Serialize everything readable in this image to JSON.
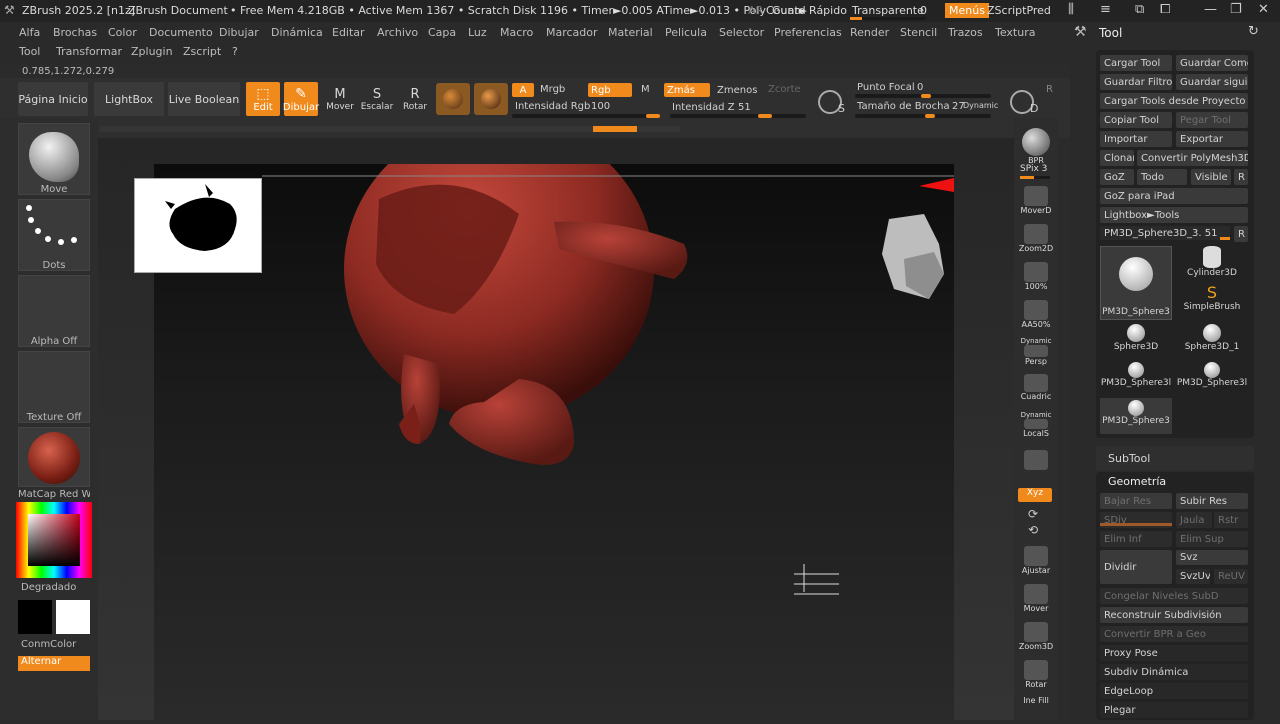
{
  "titlebar": {
    "app": "ZBrush 2025.2 [n1z]",
    "document": "ZBrush Document",
    "stats": "• Free Mem 4.218GB • Active Mem 1367 • Scratch Disk 1196 • Timer►0.005 ATime►0.013 • PolyCount►",
    "ar": "AR",
    "quicksave": "Guard Rápido",
    "transparent": "Transparente",
    "transparent_value": "0",
    "menus": "Menús",
    "zscript": "ZScriptPred"
  },
  "menus": {
    "row1": [
      "Alfa",
      "Brochas",
      "Color",
      "Documento",
      "Dibujar",
      "Dinámica",
      "Editar",
      "Archivo",
      "Capa",
      "Luz",
      "Macro",
      "Marcador",
      "Material",
      "Pelicula",
      "Selector",
      "Preferencias",
      "Render",
      "Stencil",
      "Trazos",
      "Textura"
    ],
    "row2": [
      "Tool",
      "Transformar",
      "Zplugin",
      "Zscript",
      "?"
    ]
  },
  "coords": "0.785,1.272,0.279",
  "shelf": {
    "home": "Página Inicio",
    "lightbox": "LightBox",
    "liveboolean": "Live Boolean",
    "edit": "Edit",
    "draw": "Dibujar",
    "move": "Mover",
    "scale": "Escalar",
    "rotate": "Rotar",
    "a": "A",
    "mrgb": "Mrgb",
    "rgb": "Rgb",
    "m": "M",
    "zadd": "Zmás",
    "zsub": "Zmenos",
    "zcut": "Zcorte",
    "rgb_intensity": "Intensidad Rgb",
    "rgb_intensity_value": "100",
    "z_intensity": "Intensidad Z",
    "z_intensity_value": "51",
    "focal": "Punto Focal",
    "focal_value": "0",
    "brush_size": "Tamaño de Brocha",
    "brush_size_value": "27",
    "dynamic": "Dynamic",
    "s": "S",
    "d": "D",
    "r": "R"
  },
  "left": {
    "move": "Move",
    "dots": "Dots",
    "alpha": "Alpha Off",
    "texture": "Texture Off",
    "matcap": "MatCap Red Wa",
    "gradient": "Degradado",
    "conmcolor": "ConmColor",
    "alternate": "Alternar"
  },
  "rightstrip": {
    "bpr": "BPR",
    "spix": "SPix",
    "spix_value": "3",
    "moverd": "MoverD",
    "zoom2d": "Zoom2D",
    "p100": "100%",
    "aa50": "AA50%",
    "persp_label": "Dynamic",
    "persp": "Persp",
    "floor": "Cuadric",
    "local_label": "Dynamic",
    "local": "LocalS",
    "xyz": "Xyz",
    "frame": "Ajustar",
    "move": "Mover",
    "zoom3d": "Zoom3D",
    "rotate": "Rotar",
    "linefill": "Ine Fill"
  },
  "tool": {
    "title": "Tool",
    "load": "Cargar Tool",
    "save_as": "Guardar Como",
    "save_filters": "Guardar Filtros",
    "save_next": "Guardar siguie",
    "load_project": "Cargar Tools desde Proyecto",
    "copy": "Copiar Tool",
    "paste": "Pegar Tool",
    "import": "Importar",
    "export": "Exportar",
    "clone": "Clonar",
    "convert": "Convertir PolyMesh3D",
    "goz": "GoZ",
    "all": "Todo",
    "visible": "Visible",
    "r": "R",
    "goz_ipad": "GoZ para iPad",
    "lightbox_tools": "Lightbox►Tools",
    "current": "PM3D_Sphere3D_3. 51",
    "thumbs": [
      "PM3D_Sphere3",
      "Cylinder3D",
      "SimpleBrush",
      "Sphere3D",
      "Sphere3D_1",
      "PM3D_Sphere3l",
      "PM3D_Sphere3l",
      "PM3D_Sphere3"
    ]
  },
  "subtool": {
    "title": "SubTool",
    "geometry": "Geometría",
    "lower_res": "Bajar Res",
    "higher_res": "Subir Res",
    "sdiv": "SDiv",
    "cage": "Jaula",
    "rstr": "Rstr",
    "del_lower": "Elim Inf",
    "del_higher": "Elim Sup",
    "divide": "Dividir",
    "svz": "Svz",
    "svzuv": "SvzUv",
    "reuv": "ReUV",
    "freeze": "Congelar Niveles SubD",
    "reconstruct": "Reconstruir Subdivisión",
    "convert_bpr": "Convertir BPR a Geo",
    "proxy": "Proxy Pose",
    "dynamic_subdiv": "Subdiv Dinámica",
    "edgeloop": "EdgeLoop",
    "crease": "Plegar"
  }
}
